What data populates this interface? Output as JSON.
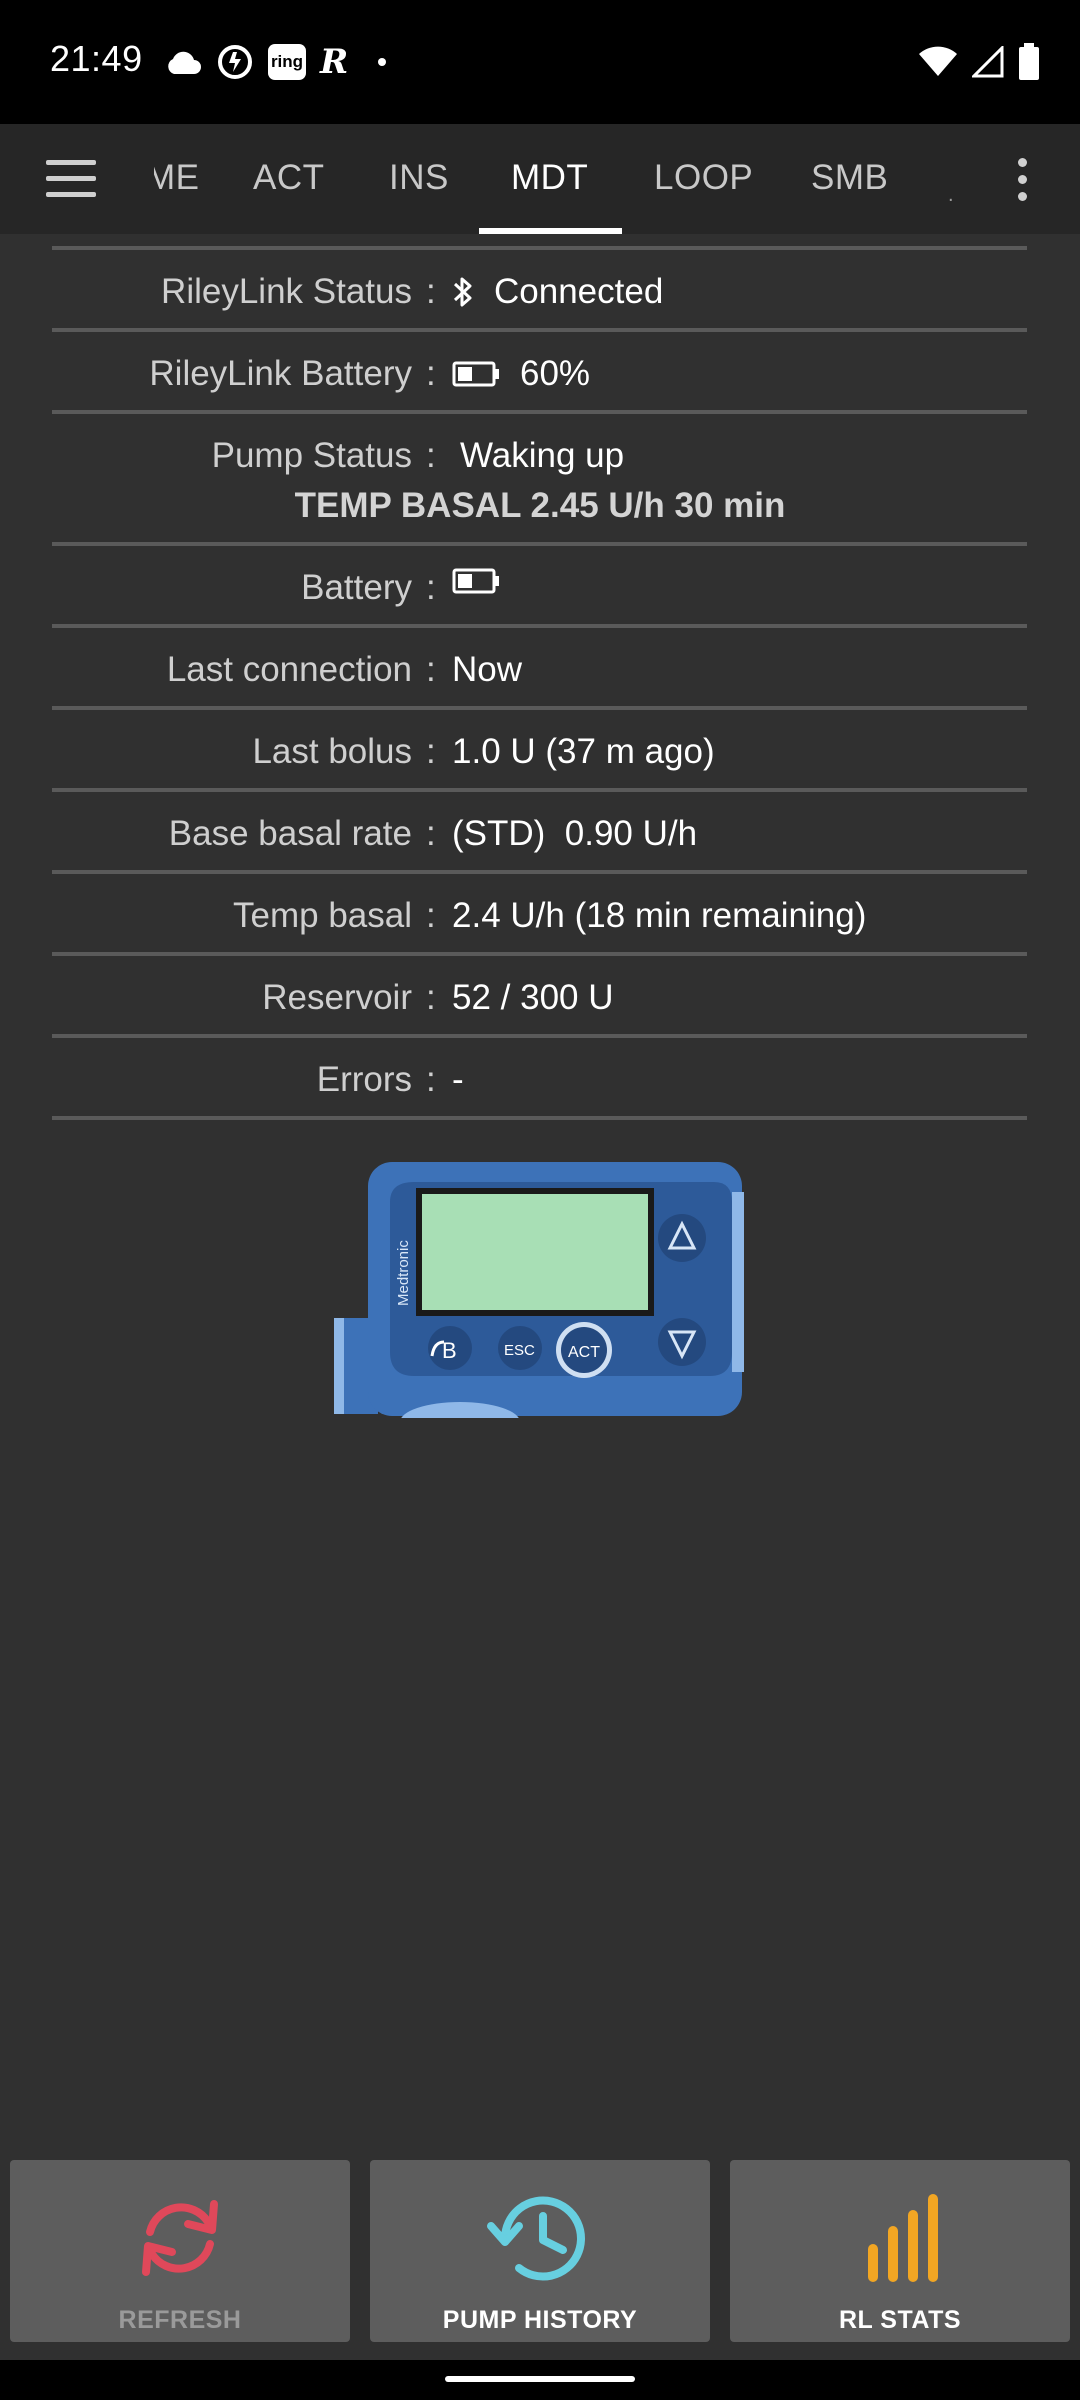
{
  "status_bar": {
    "time": "21:49",
    "ring_badge": "ring",
    "r_app": "R",
    "left_icons": [
      "cloud-icon",
      "sync-icon",
      "ring-badge",
      "r-icon",
      "notification-dot"
    ],
    "right_icons": [
      "wifi-icon",
      "cell-signal-icon",
      "battery-icon"
    ]
  },
  "tabs": {
    "items": [
      {
        "label": "ME",
        "active": false
      },
      {
        "label": "ACT",
        "active": false
      },
      {
        "label": "INS",
        "active": false
      },
      {
        "label": "MDT",
        "active": true
      },
      {
        "label": "LOOP",
        "active": false
      },
      {
        "label": "SMB",
        "active": false
      }
    ],
    "edge_glyph": "."
  },
  "rows": {
    "rileylink_status": {
      "label": "RileyLink Status",
      "value": "Connected"
    },
    "rileylink_battery": {
      "label": "RileyLink Battery",
      "value": "60%"
    },
    "pump_status": {
      "label": "Pump Status",
      "value": "Waking up",
      "subvalue": "TEMP BASAL 2.45 U/h 30 min"
    },
    "battery": {
      "label": "Battery",
      "value": ""
    },
    "last_connection": {
      "label": "Last connection",
      "value": "Now"
    },
    "last_bolus": {
      "label": "Last bolus",
      "value": "1.0 U (37 m ago)"
    },
    "base_basal_rate": {
      "label": "Base basal rate",
      "value": "(STD)  0.90 U/h"
    },
    "temp_basal": {
      "label": "Temp basal",
      "value": "2.4 U/h (18 min remaining)"
    },
    "reservoir": {
      "label": "Reservoir",
      "value": "52 / 300 U"
    },
    "errors": {
      "label": "Errors",
      "value": "-"
    }
  },
  "colon": ":",
  "pump_image": {
    "brand": "Medtronic",
    "buttons": [
      "B",
      "ESC",
      "ACT"
    ],
    "screen_color": "#a8dfb5",
    "body_color": "#3d72b8"
  },
  "buttons": {
    "refresh": {
      "label": "REFRESH",
      "icon": "refresh-icon",
      "color": "#e0485a",
      "enabled": false
    },
    "pump_history": {
      "label": "PUMP HISTORY",
      "icon": "history-icon",
      "color": "#67cfe0"
    },
    "rl_stats": {
      "label": "RL STATS",
      "icon": "stats-bars-icon",
      "color": "#f2a623"
    }
  },
  "colors": {
    "background": "#303030",
    "tabbar": "#262626",
    "button_bg": "#5d5d5d",
    "divider": "#5a5a5a"
  }
}
